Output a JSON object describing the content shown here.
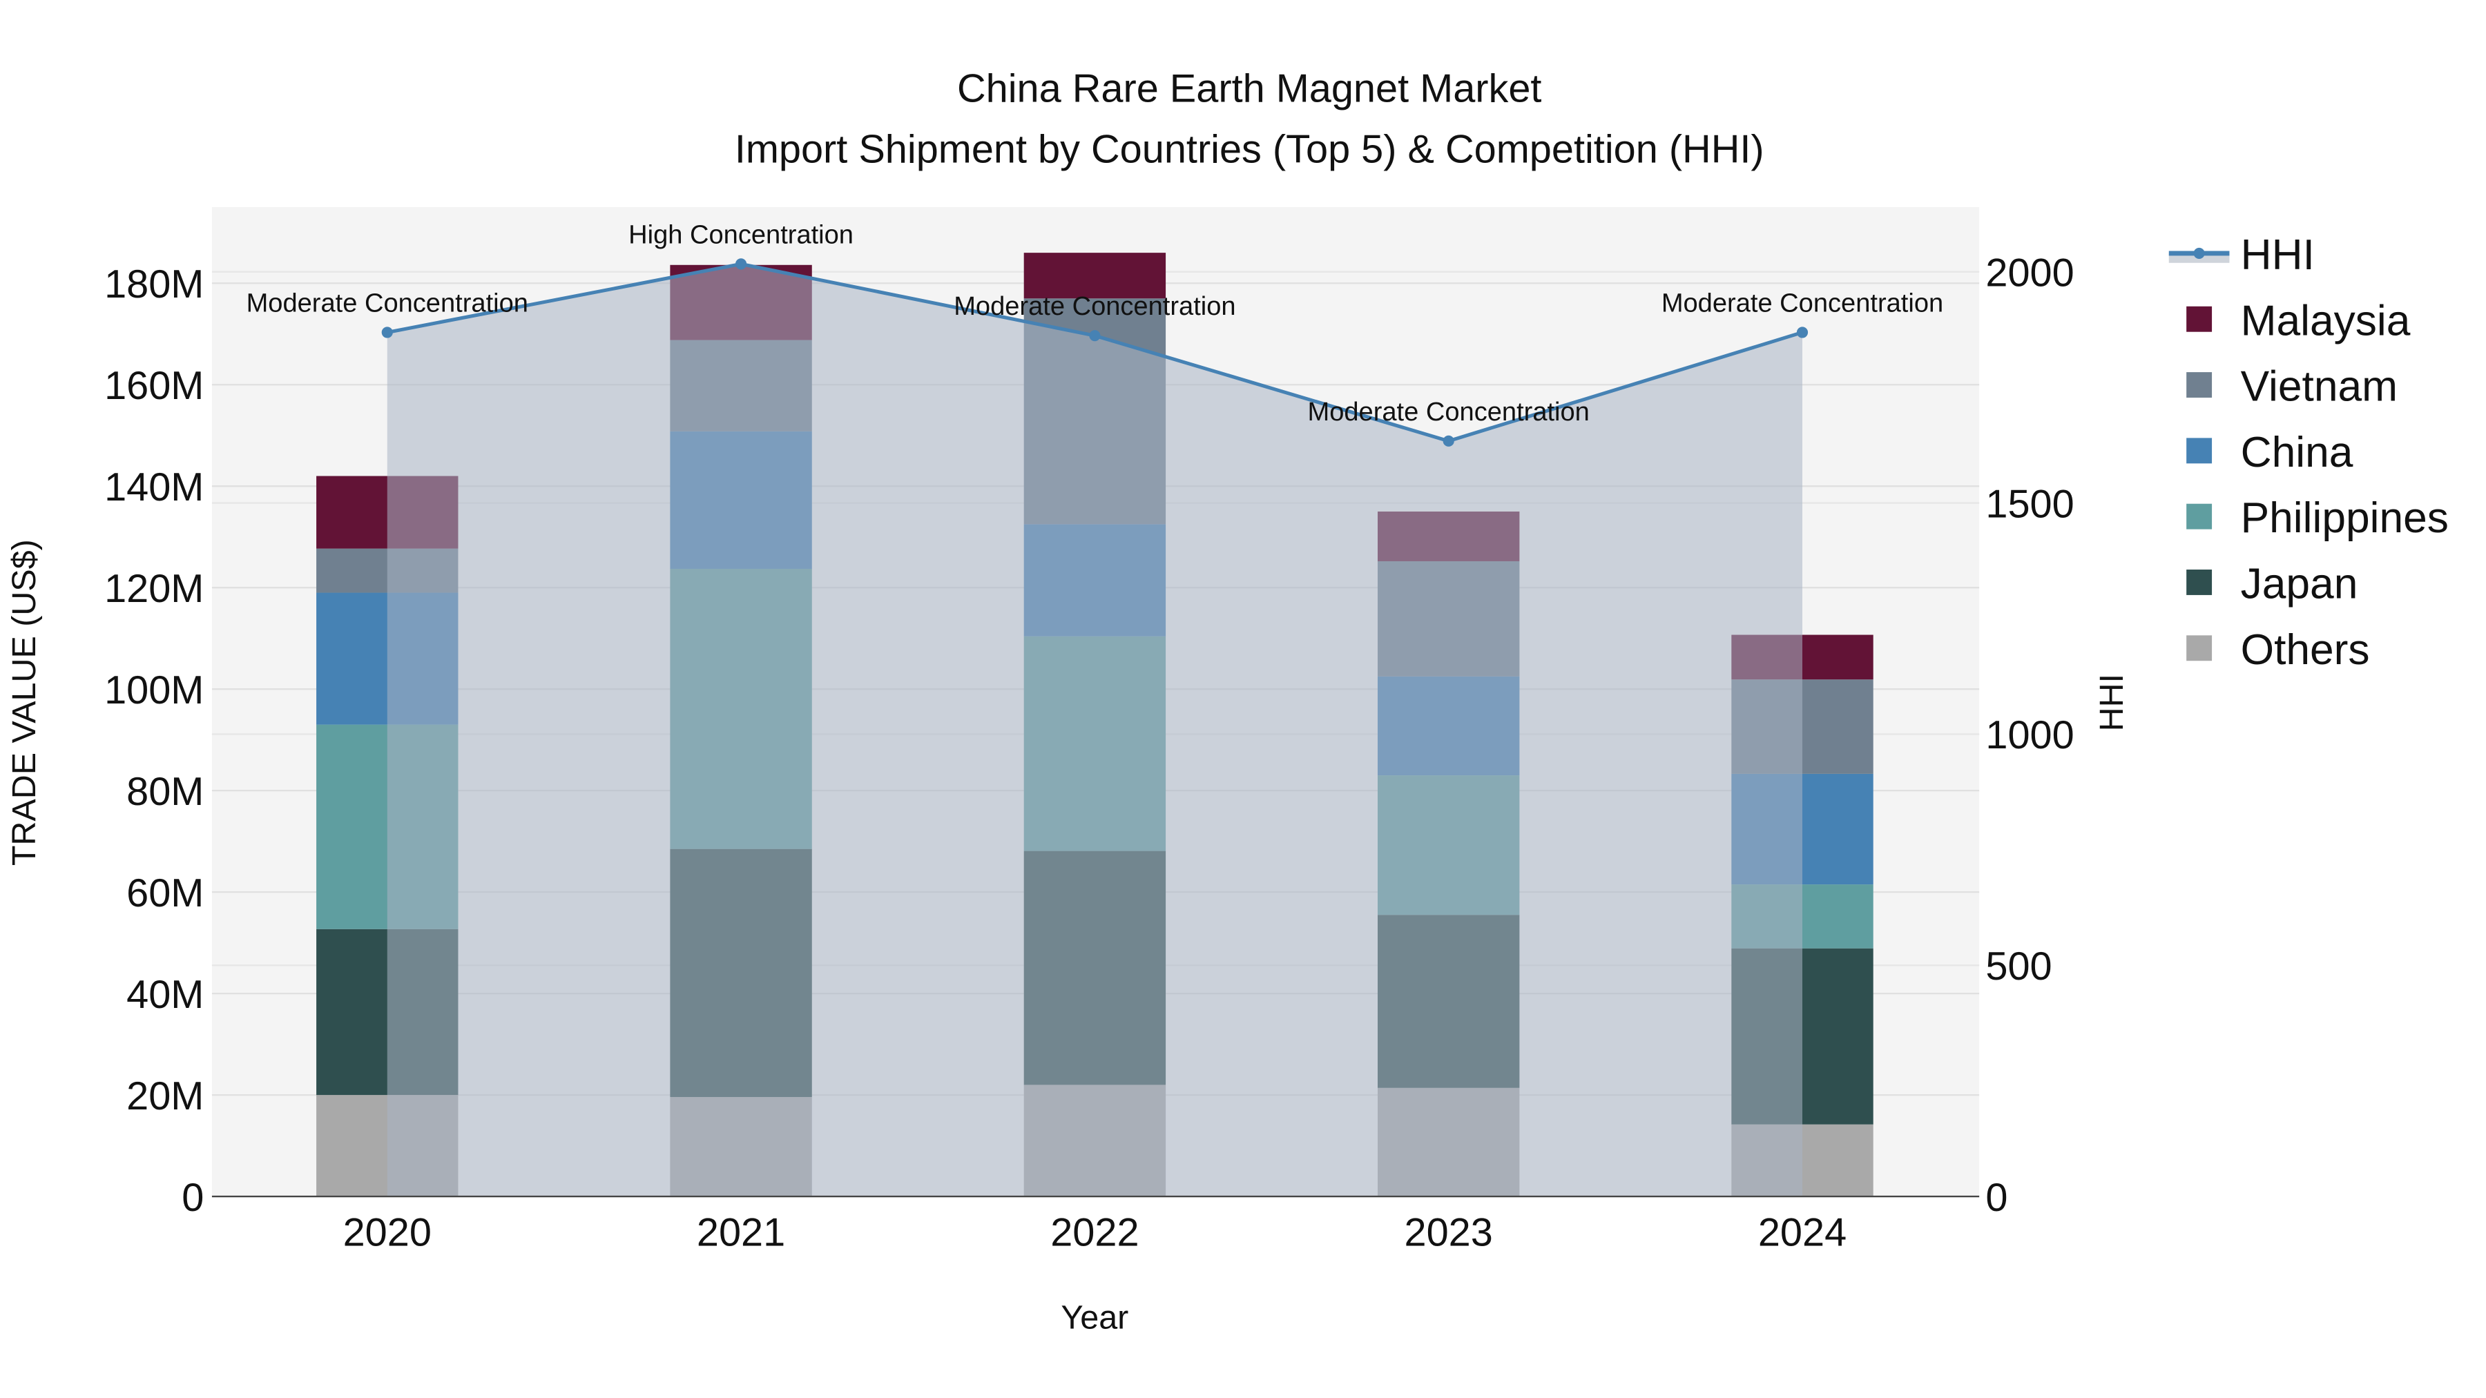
{
  "chart_data": {
    "type": "bar",
    "title_line1": "China Rare Earth Magnet Market",
    "title_line2": "Import Shipment by Countries (Top 5) & Competition (HHI)",
    "xlabel": "Year",
    "ylabel": "TRADE VALUE (US$)",
    "y2label": "HHI",
    "categories": [
      "2020",
      "2021",
      "2022",
      "2023",
      "2024"
    ],
    "ylim": [
      0,
      195
    ],
    "yunit": "M",
    "yticks": [
      0,
      20,
      40,
      60,
      80,
      100,
      120,
      140,
      160,
      180
    ],
    "ytick_labels": [
      "0",
      "20M",
      "40M",
      "60M",
      "80M",
      "100M",
      "120M",
      "140M",
      "160M",
      "180M"
    ],
    "y2lim": [
      0,
      2140
    ],
    "y2ticks": [
      0,
      500,
      1000,
      1500,
      2000
    ],
    "y2tick_labels": [
      "0",
      "500",
      "1000",
      "1500",
      "2000"
    ],
    "grid": true,
    "legend_position": "right",
    "series": [
      {
        "name": "Others",
        "color": "#a9a9a9",
        "values": [
          20.0,
          19.6,
          22.0,
          21.4,
          14.2
        ]
      },
      {
        "name": "Japan",
        "color": "#2f4f4f",
        "values": [
          32.7,
          48.9,
          46.1,
          34.1,
          34.7
        ]
      },
      {
        "name": "Philippines",
        "color": "#5f9ea0",
        "values": [
          40.3,
          55.2,
          42.3,
          27.5,
          12.6
        ]
      },
      {
        "name": "China",
        "color": "#4682b4",
        "values": [
          26.0,
          27.1,
          22.1,
          19.5,
          21.8
        ]
      },
      {
        "name": "Vietnam",
        "color": "#708090",
        "values": [
          8.7,
          18.0,
          44.5,
          22.7,
          18.6
        ]
      },
      {
        "name": "Malaysia",
        "color": "#621336",
        "values": [
          14.3,
          14.8,
          9.0,
          9.8,
          8.8
        ]
      }
    ],
    "hhi": {
      "name": "HHI",
      "color": "#4682b4",
      "values": [
        1869,
        2017,
        1862,
        1634,
        1869
      ],
      "annotations": [
        "Moderate Concentration",
        "High Concentration",
        "Moderate Concentration",
        "Moderate Concentration",
        "Moderate Concentration"
      ]
    },
    "legend_order": [
      "HHI",
      "Malaysia",
      "Vietnam",
      "China",
      "Philippines",
      "Japan",
      "Others"
    ]
  }
}
